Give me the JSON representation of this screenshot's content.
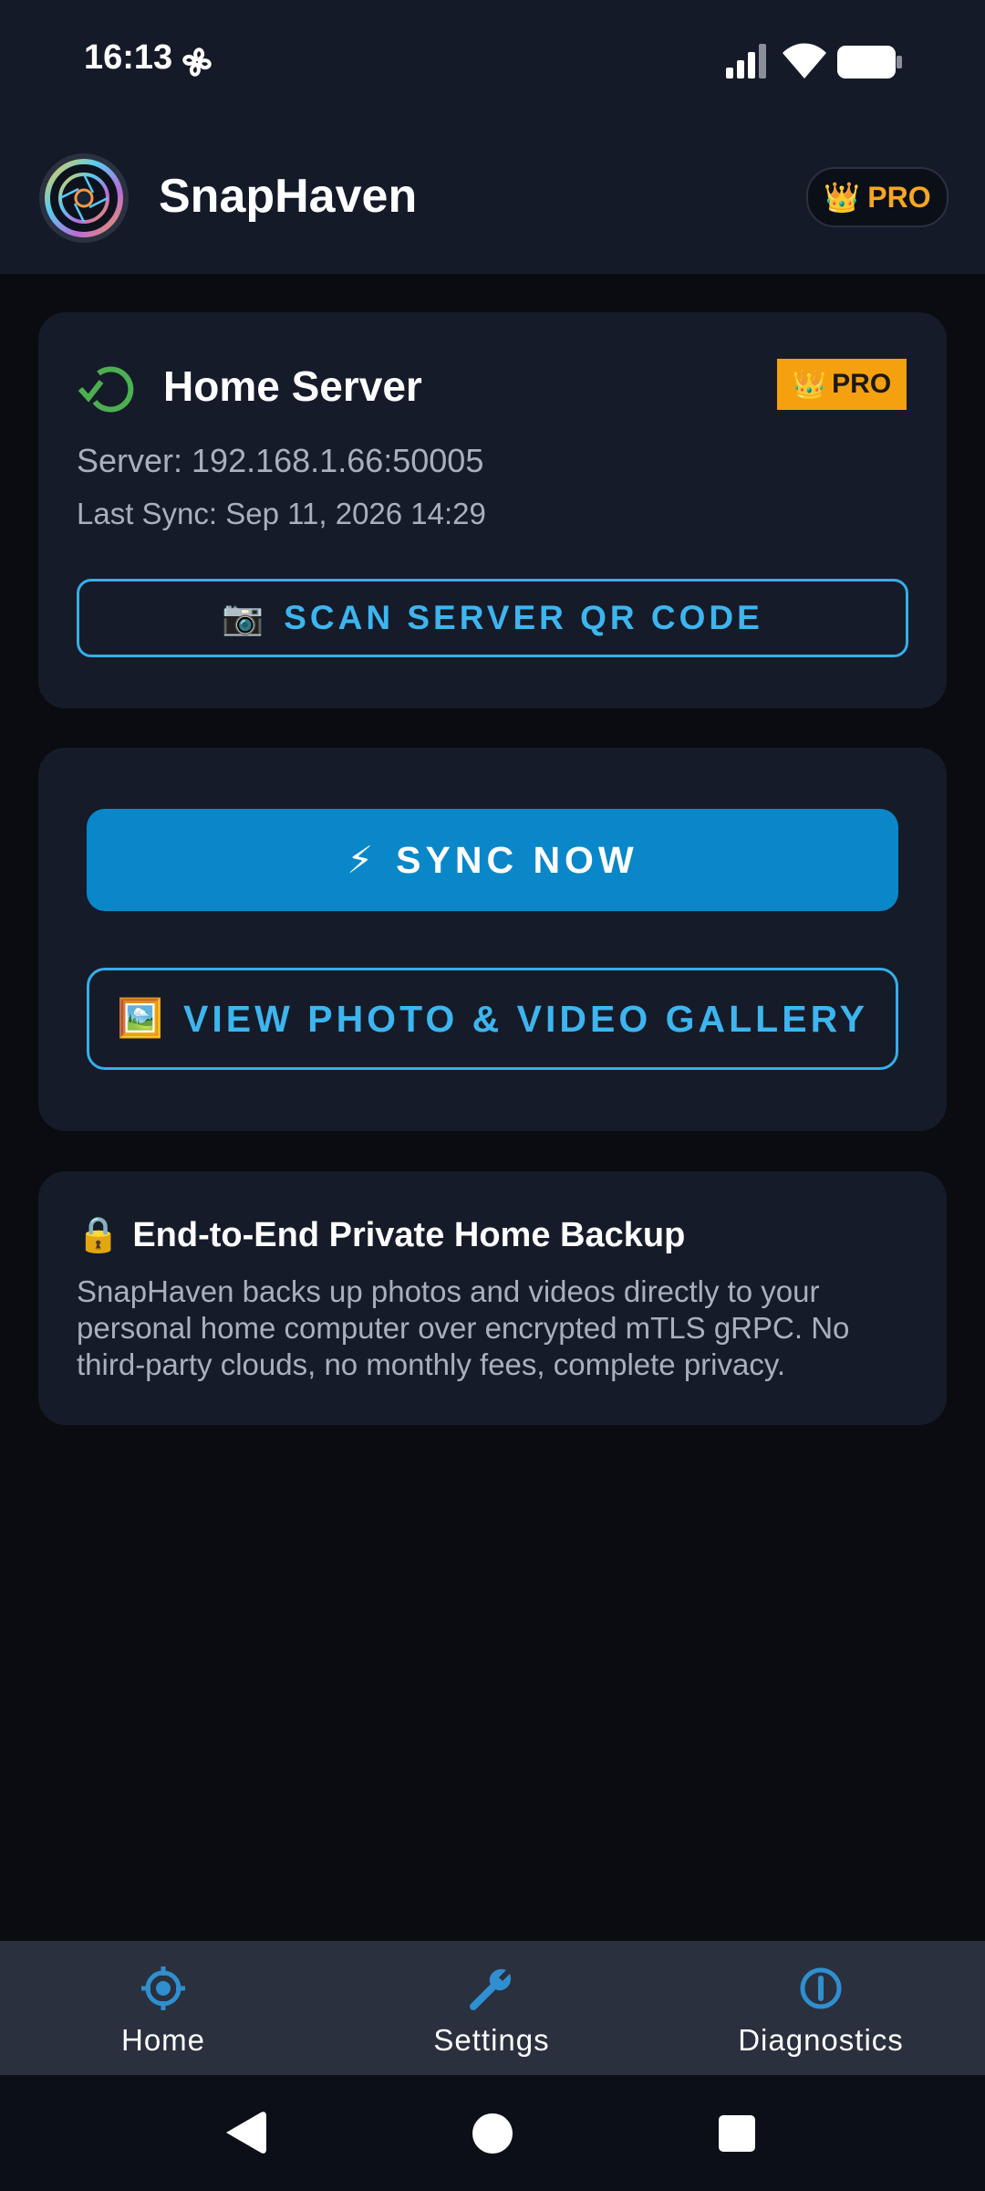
{
  "status_bar": {
    "time": "16:13"
  },
  "app_bar": {
    "title": "SnapHaven",
    "pro_label": "PRO",
    "pro_icon": "crown-icon"
  },
  "server_card": {
    "name": "Home Server",
    "pro_label": "PRO",
    "address": "Server: 192.168.1.66:50005",
    "last_sync": "Last Sync: Sep 11, 2026 14:29",
    "scan_button_icon": "📷",
    "scan_button_label": "SCAN SERVER QR CODE",
    "status_color": "#4caf50"
  },
  "actions_card": {
    "sync_icon": "⚡",
    "sync_label": "SYNC NOW",
    "gallery_icon": "🖼️",
    "gallery_label": "VIEW PHOTO & VIDEO GALLERY"
  },
  "info_card": {
    "icon": "🔒",
    "title": "End-to-End Private Home Backup",
    "body": "SnapHaven backs up photos and videos directly to your personal home computer over encrypted mTLS gRPC. No third-party clouds, no monthly fees, complete privacy."
  },
  "bottom_nav": {
    "items": [
      {
        "label": "Home",
        "icon": "target-icon"
      },
      {
        "label": "Settings",
        "icon": "wrench-icon"
      },
      {
        "label": "Diagnostics",
        "icon": "info-icon"
      }
    ]
  },
  "colors": {
    "accent": "#3db5ef",
    "primary_button": "#0a87c9",
    "pro": "#f5a623"
  }
}
